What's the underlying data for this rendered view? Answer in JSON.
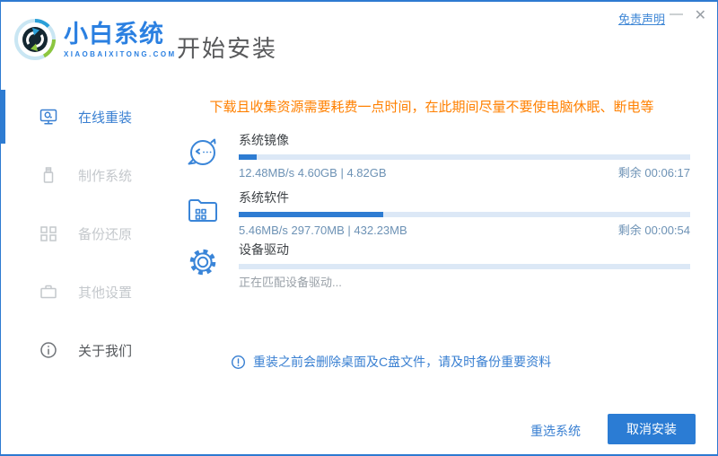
{
  "colors": {
    "accent_blue": "#2e7cd2",
    "border_blue": "#2e7ad1",
    "warning_orange": "#ff8000",
    "progress_track": "#dce8f6",
    "inactive_gray": "#c4c8cc"
  },
  "header": {
    "logo_title": "小白系统",
    "logo_subtitle": "XIAOBAIXITONG.COM",
    "logo_icon": "recycle-globe-icon",
    "page_title": "开始安装",
    "disclaimer_link": "免责声明",
    "minimize_label": "—",
    "close_label": "✕"
  },
  "sidebar": {
    "items": [
      {
        "label": "在线重装",
        "icon": "monitor-icon",
        "active": true
      },
      {
        "label": "制作系统",
        "icon": "usb-icon",
        "active": false
      },
      {
        "label": "备份还原",
        "icon": "grid-squares-icon",
        "active": false
      },
      {
        "label": "其他设置",
        "icon": "briefcase-icon",
        "active": false
      },
      {
        "label": "关于我们",
        "icon": "info-circle-icon",
        "active": false
      }
    ]
  },
  "main": {
    "warning_text": "下载且收集资源需要耗费一点时间，在此期间尽量不要使电脑休眠、断电等",
    "tasks": [
      {
        "icon": "face-icon",
        "name": "系统镜像",
        "stats": "12.48MB/s 4.60GB | 4.82GB",
        "remaining": "剩余 00:06:17",
        "progress_percent": 4
      },
      {
        "icon": "folder-grid-icon",
        "name": "系统软件",
        "stats": "5.46MB/s 297.70MB | 432.23MB",
        "remaining": "剩余 00:00:54",
        "progress_percent": 32
      },
      {
        "icon": "gear-icon",
        "name": "设备驱动",
        "stats": "正在匹配设备驱动...",
        "remaining": "",
        "progress_percent": 0
      }
    ],
    "note_icon": "exclamation-circle-icon",
    "note_text": "重装之前会删除桌面及C盘文件，请及时备份重要资料"
  },
  "footer": {
    "reselect_label": "重选系统",
    "cancel_label": "取消安装"
  }
}
